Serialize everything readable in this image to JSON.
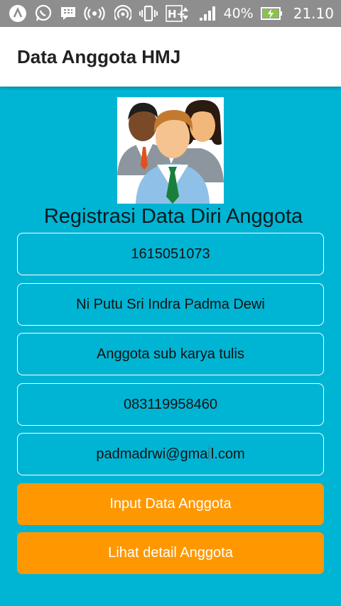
{
  "status_bar": {
    "battery_percent": "40%",
    "time": "21.10",
    "network_type": "H+",
    "icons": [
      "app-a-icon",
      "whatsapp-icon",
      "bbm-icon",
      "broadcast-icon",
      "hotspot-icon",
      "vibrate-icon",
      "network-type-icon",
      "signal-icon",
      "battery-charging-icon"
    ],
    "colors": {
      "background": "#8e8e8e"
    }
  },
  "app_bar": {
    "title": "Data Anggota HMJ"
  },
  "form": {
    "heading": "Registrasi Data Diri Anggota",
    "fields": [
      {
        "name": "nim-field",
        "value": "1615051073"
      },
      {
        "name": "name-field",
        "value": "Ni Putu Sri Indra Padma Dewi"
      },
      {
        "name": "position-field",
        "value": "Anggota sub karya tulis"
      },
      {
        "name": "phone-field",
        "value": "083119958460"
      },
      {
        "name": "email-field",
        "value": "padmadrwi@gmail.com"
      }
    ],
    "buttons": {
      "input_label": "Input Data Anggota",
      "detail_label": "Lihat detail Anggota"
    }
  },
  "theme": {
    "background": "#00b4d4",
    "button": "#ff9800",
    "appbar": "#ffffff"
  }
}
